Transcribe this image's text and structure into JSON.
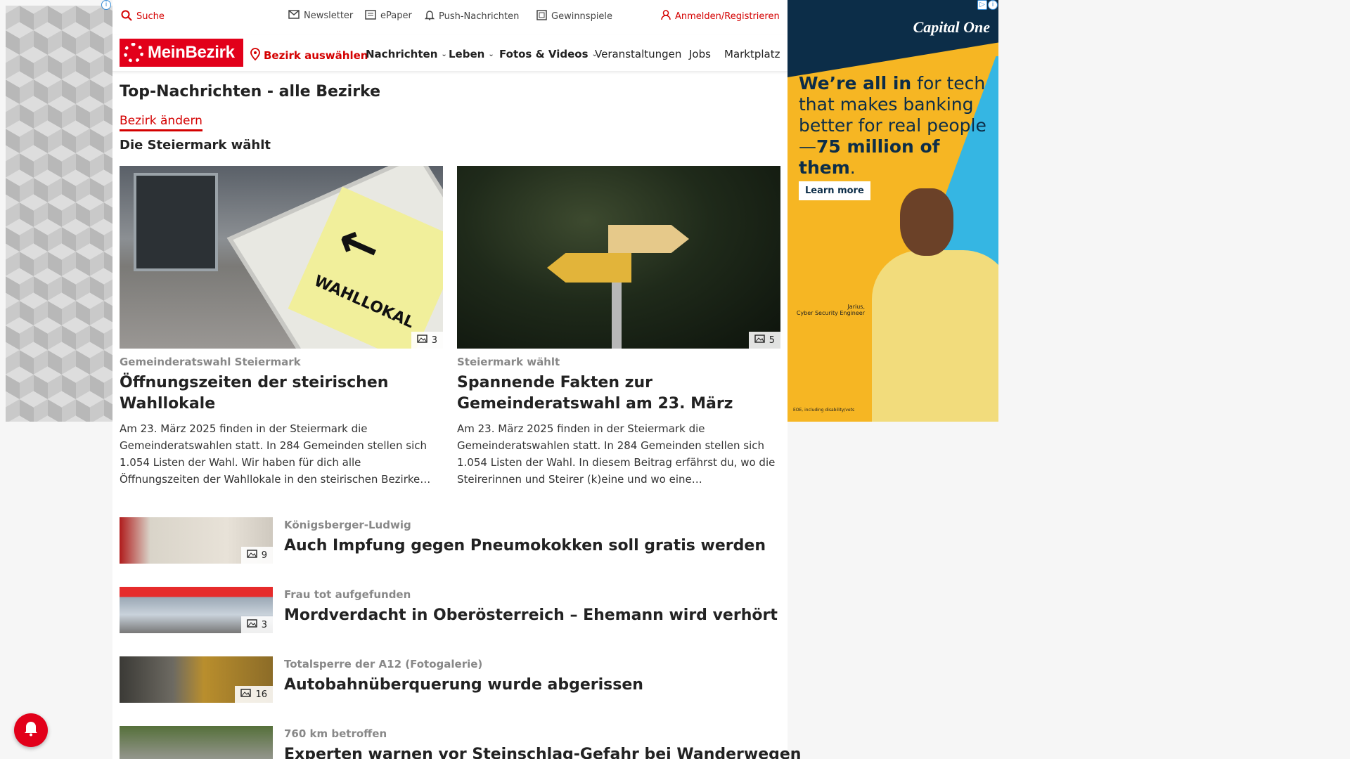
{
  "topbar": {
    "search_label": "Suche",
    "newsletter_label": "Newsletter",
    "epaper_label": "ePaper",
    "push_label": "Push-Nachrichten",
    "gewinnspiele_label": "Gewinnspiele",
    "login_label": "Anmelden/Registrieren"
  },
  "nav": {
    "logo_text": "MeinBezirk",
    "bezirk_label": "Bezirk auswählen",
    "items": [
      {
        "label": "Nachrichten"
      },
      {
        "label": "Leben"
      },
      {
        "label": "Fotos & Videos"
      },
      {
        "label": "Veranstaltungen"
      },
      {
        "label": "Jobs"
      },
      {
        "label": "Marktplatz"
      }
    ]
  },
  "page": {
    "title": "Top-Nachrichten - alle Bezirke",
    "change_link": "Bezirk ändern",
    "section_title": "Die Steiermark wählt"
  },
  "cards": [
    {
      "image_count": "3",
      "kicker": "Gemeinderatswahl Steiermark",
      "title": "Öffnungszeiten der steirischen Wahllokale",
      "teaser": "Am 23. März 2025 finden in der Steiermark die Gemeinderatswahlen statt. In 284 Gemeinden stellen sich 1.054 Listen der Wahl. Wir haben für dich alle Öffnungszeiten der Wahllokale in den steirischen Bezirke…",
      "image_sign_text": "WAHLLOKAL"
    },
    {
      "image_count": "5",
      "kicker": "Steiermark wählt",
      "title": "Spannende Fakten zur Gemeinderatswahl am 23. März",
      "teaser": "Am 23. März 2025 finden in der Steiermark die Gemeinderatswahlen statt. In 284 Gemeinden stellen sich 1.054 Listen der Wahl. In diesem Beitrag erfährst du, wo die Steirerinnen und Steirer (k)eine und wo eine…"
    }
  ],
  "list": [
    {
      "image_count": "9",
      "kicker": "Königsberger-Ludwig",
      "title": "Auch Impfung gegen Pneumokokken soll gratis werden"
    },
    {
      "image_count": "3",
      "kicker": "Frau tot aufgefunden",
      "title": "Mordverdacht in Oberösterreich – Ehemann wird verhört"
    },
    {
      "image_count": "16",
      "kicker": "Totalsperre der A12 (Fotogalerie)",
      "title": "Autobahnüberquerung wurde abgerissen"
    },
    {
      "image_count": "",
      "kicker": "760 km betroffen",
      "title": "Experten warnen vor Steinschlag-Gefahr bei Wanderwegen"
    }
  ],
  "ad_right": {
    "brand": "Capital One",
    "headline_bold_1": "We’re all in",
    "headline_1": " for tech that makes banking better for real people—",
    "headline_bold_2": "75 million of them",
    "headline_end": ".",
    "cta": "Learn more",
    "caption_name": "Jarius,",
    "caption_role": "Cyber Security Engineer",
    "fine_print": "EOE, including disability/vets"
  },
  "colors": {
    "brand_red": "#e2001a",
    "link_red": "#d40000",
    "kicker_gray": "#888888"
  },
  "icons": {
    "search": "search-icon",
    "newsletter": "mail-icon",
    "epaper": "newspaper-icon",
    "push": "bell-icon",
    "gewinnspiele": "gift-icon",
    "login": "user-icon",
    "bezirk": "location-pin-icon",
    "image_count": "image-icon",
    "floating": "notification-bell-icon"
  }
}
